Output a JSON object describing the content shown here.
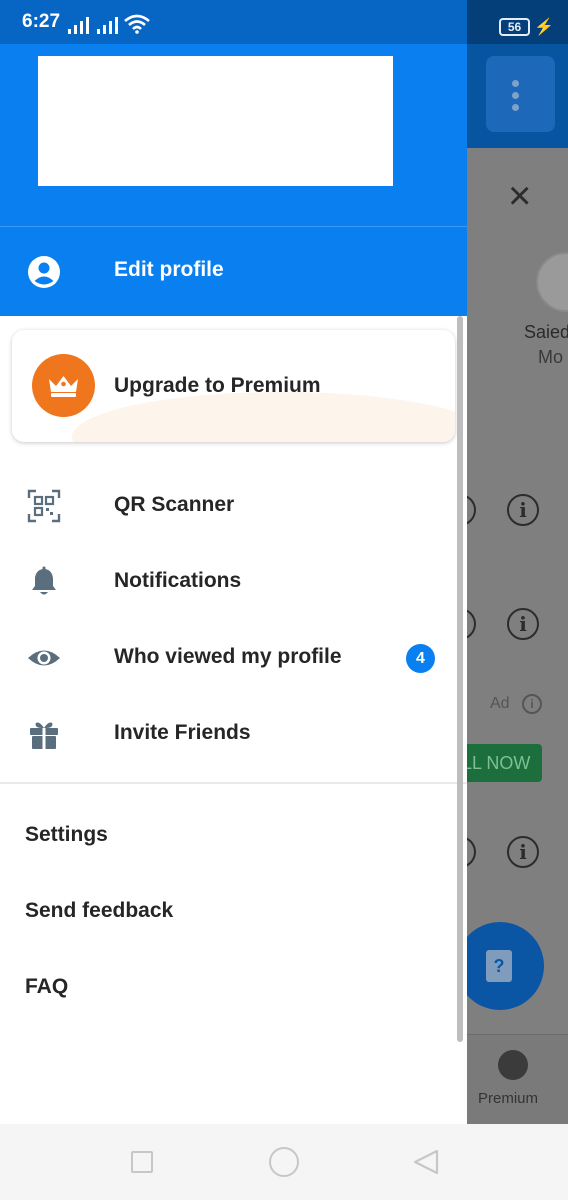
{
  "status_bar": {
    "time": "6:27",
    "battery": "56"
  },
  "drawer": {
    "edit_profile": {
      "label": "Edit profile",
      "icon": "account-circle-icon"
    },
    "premium": {
      "label": "Upgrade to Premium",
      "icon": "crown-icon",
      "badge_color": "#F0761E"
    },
    "items": [
      {
        "label": "QR Scanner",
        "icon": "qr-code-icon"
      },
      {
        "label": "Notifications",
        "icon": "bell-icon"
      },
      {
        "label": "Who viewed my profile",
        "icon": "eye-icon",
        "badge": "4"
      },
      {
        "label": "Invite Friends",
        "icon": "gift-icon"
      }
    ],
    "secondary_items": [
      {
        "label": "Settings"
      },
      {
        "label": "Send feedback"
      },
      {
        "label": "FAQ"
      }
    ]
  },
  "background": {
    "contact_name": "Saied",
    "contact_sub": "Mo",
    "ad_label": "Ad",
    "cta_label": "LL NOW",
    "bottom_tab": "Premium"
  },
  "colors": {
    "primary": "#0A7FF0",
    "text": "#262626",
    "icon": "#5B6E7E",
    "premium": "#F0761E"
  }
}
